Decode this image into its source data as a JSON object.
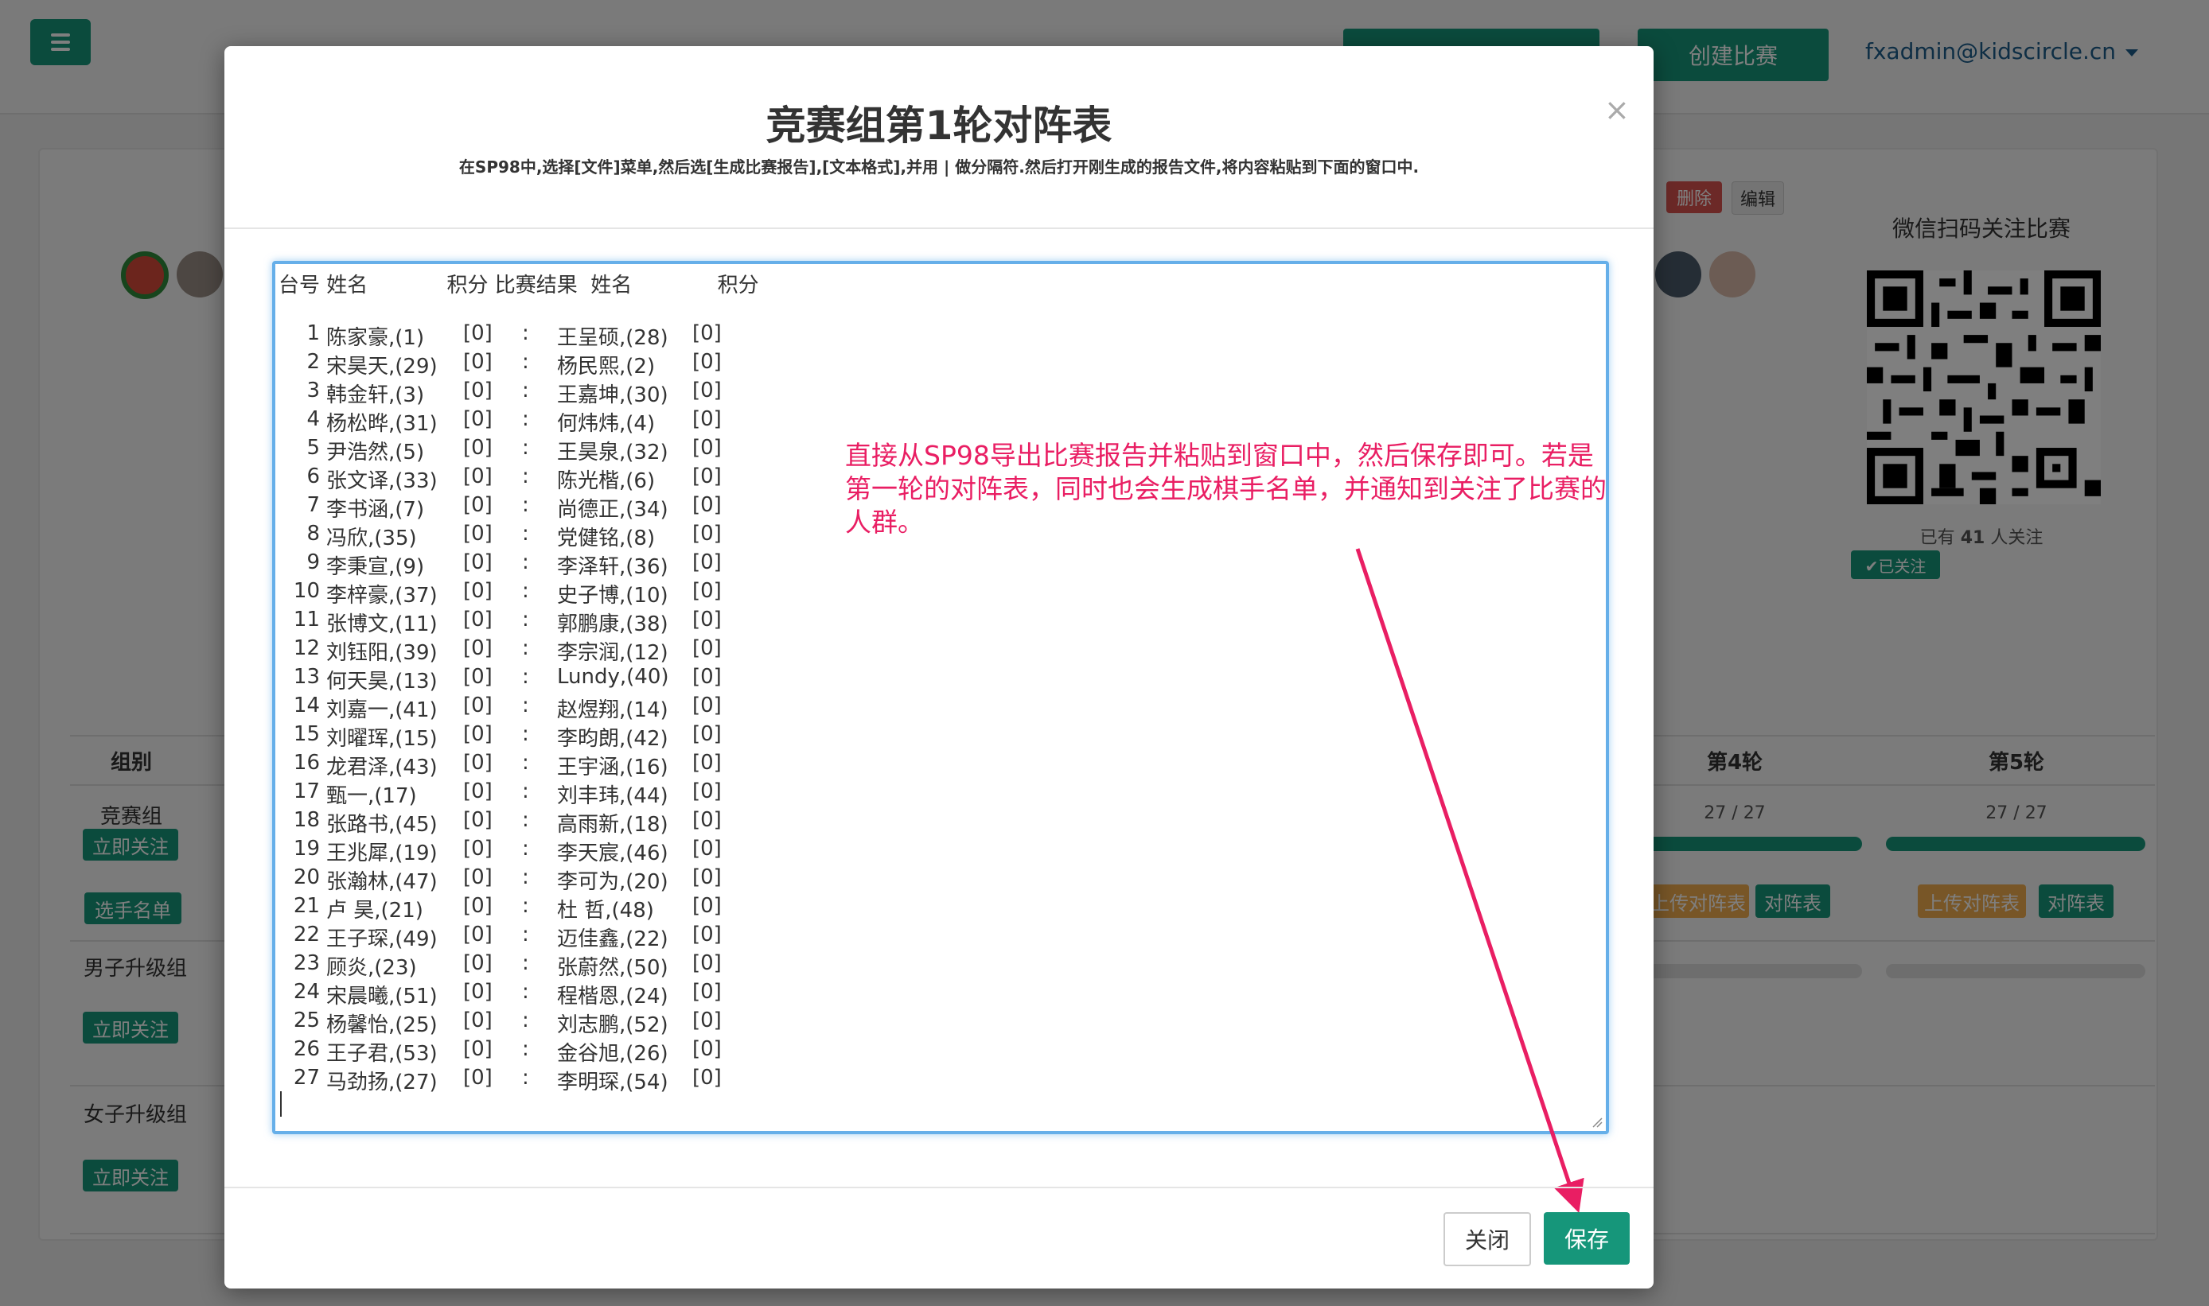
{
  "background": {
    "create_button": "创建比赛",
    "user_email": "fxadmin@kidscircle.cn",
    "delete_badge": "删除",
    "edit_badge": "编辑",
    "qr_title": "微信扫码关注比赛",
    "follow_count_prefix": "已有",
    "follow_count_value": "41",
    "follow_count_suffix": "人关注",
    "followed_badge": "✔已关注",
    "table": {
      "group_header": "组别",
      "round4_header": "第4轮",
      "round5_header": "第5轮",
      "groups": [
        {
          "name": "竞赛组",
          "follow_btn": "立即关注",
          "players_btn": "选手名单"
        },
        {
          "name": "男子升级组",
          "follow_btn": "立即关注"
        },
        {
          "name": "女子升级组",
          "follow_btn": "立即关注"
        }
      ],
      "round4_ratio": "27 / 27",
      "round5_ratio": "27 / 27",
      "round4_progress": 1.0,
      "round5_progress": 1.0,
      "upload_btn_r4": "上传对阵表",
      "pairing_btn_r4": "对阵表",
      "upload_btn_r5": "上传对阵表",
      "pairing_btn_r5": "对阵表"
    }
  },
  "modal": {
    "title": "竞赛组第1轮对阵表",
    "subtitle": "在SP98中,选择[文件]菜单,然后选[生成比赛报告],[文本格式],并用 | 做分隔符.然后打开刚生成的报告文件,将内容粘贴到下面的窗口中.",
    "close_symbol": "×",
    "textarea_header": "台号 姓名            积分 比赛结果  姓名             积分",
    "pairings": [
      {
        "no": "1",
        "p1": "陈家豪,(1)",
        "s1": "[0]",
        "sep": ":",
        "p2": "王呈硕,(28)",
        "s2": "[0]"
      },
      {
        "no": "2",
        "p1": "宋昊天,(29)",
        "s1": "[0]",
        "sep": ":",
        "p2": "杨民熙,(2)",
        "s2": "[0]"
      },
      {
        "no": "3",
        "p1": "韩金轩,(3)",
        "s1": "[0]",
        "sep": ":",
        "p2": "王嘉坤,(30)",
        "s2": "[0]"
      },
      {
        "no": "4",
        "p1": "杨松晔,(31)",
        "s1": "[0]",
        "sep": ":",
        "p2": "何炜炜,(4)",
        "s2": "[0]"
      },
      {
        "no": "5",
        "p1": "尹浩然,(5)",
        "s1": "[0]",
        "sep": ":",
        "p2": "王昊泉,(32)",
        "s2": "[0]"
      },
      {
        "no": "6",
        "p1": "张文译,(33)",
        "s1": "[0]",
        "sep": ":",
        "p2": "陈光楷,(6)",
        "s2": "[0]"
      },
      {
        "no": "7",
        "p1": "李书涵,(7)",
        "s1": "[0]",
        "sep": ":",
        "p2": "尚德正,(34)",
        "s2": "[0]"
      },
      {
        "no": "8",
        "p1": "冯欣,(35)",
        "s1": "[0]",
        "sep": ":",
        "p2": "党健铭,(8)",
        "s2": "[0]"
      },
      {
        "no": "9",
        "p1": "李秉宣,(9)",
        "s1": "[0]",
        "sep": ":",
        "p2": "李泽轩,(36)",
        "s2": "[0]"
      },
      {
        "no": "10",
        "p1": "李梓豪,(37)",
        "s1": "[0]",
        "sep": ":",
        "p2": "史子博,(10)",
        "s2": "[0]"
      },
      {
        "no": "11",
        "p1": "张博文,(11)",
        "s1": "[0]",
        "sep": ":",
        "p2": "郭鹏康,(38)",
        "s2": "[0]"
      },
      {
        "no": "12",
        "p1": "刘钰阳,(39)",
        "s1": "[0]",
        "sep": ":",
        "p2": "李宗润,(12)",
        "s2": "[0]"
      },
      {
        "no": "13",
        "p1": "何天昊,(13)",
        "s1": "[0]",
        "sep": ":",
        "p2": "Lundy,(40)",
        "s2": "[0]"
      },
      {
        "no": "14",
        "p1": "刘嘉一,(41)",
        "s1": "[0]",
        "sep": ":",
        "p2": "赵煜翔,(14)",
        "s2": "[0]"
      },
      {
        "no": "15",
        "p1": "刘曜珲,(15)",
        "s1": "[0]",
        "sep": ":",
        "p2": "李昀朗,(42)",
        "s2": "[0]"
      },
      {
        "no": "16",
        "p1": "龙君泽,(43)",
        "s1": "[0]",
        "sep": ":",
        "p2": "王宇涵,(16)",
        "s2": "[0]"
      },
      {
        "no": "17",
        "p1": "甄一,(17)",
        "s1": "[0]",
        "sep": ":",
        "p2": "刘丰玮,(44)",
        "s2": "[0]"
      },
      {
        "no": "18",
        "p1": "张路书,(45)",
        "s1": "[0]",
        "sep": ":",
        "p2": "高雨新,(18)",
        "s2": "[0]"
      },
      {
        "no": "19",
        "p1": "王兆犀,(19)",
        "s1": "[0]",
        "sep": ":",
        "p2": "李天宸,(46)",
        "s2": "[0]"
      },
      {
        "no": "20",
        "p1": "张瀚林,(47)",
        "s1": "[0]",
        "sep": ":",
        "p2": "李可为,(20)",
        "s2": "[0]"
      },
      {
        "no": "21",
        "p1": "卢 昊,(21)",
        "s1": "[0]",
        "sep": ":",
        "p2": "杜 哲,(48)",
        "s2": "[0]"
      },
      {
        "no": "22",
        "p1": "王子琛,(49)",
        "s1": "[0]",
        "sep": ":",
        "p2": "迈佳鑫,(22)",
        "s2": "[0]"
      },
      {
        "no": "23",
        "p1": "顾炎,(23)",
        "s1": "[0]",
        "sep": ":",
        "p2": "张蔚然,(50)",
        "s2": "[0]"
      },
      {
        "no": "24",
        "p1": "宋晨曦,(51)",
        "s1": "[0]",
        "sep": ":",
        "p2": "程楷恩,(24)",
        "s2": "[0]"
      },
      {
        "no": "25",
        "p1": "杨馨怡,(25)",
        "s1": "[0]",
        "sep": ":",
        "p2": "刘志鹏,(52)",
        "s2": "[0]"
      },
      {
        "no": "26",
        "p1": "王子君,(53)",
        "s1": "[0]",
        "sep": ":",
        "p2": "金谷旭,(26)",
        "s2": "[0]"
      },
      {
        "no": "27",
        "p1": "马劲扬,(27)",
        "s1": "[0]",
        "sep": ":",
        "p2": "李明琛,(54)",
        "s2": "[0]"
      }
    ],
    "annotation": "直接从SP98导出比赛报告并粘贴到窗口中，然后保存即可。若是第一轮的对阵表，同时也会生成棋手名单，并通知到关注了比赛的人群。",
    "close_button": "关闭",
    "save_button": "保存"
  },
  "colors": {
    "primary": "#16967a",
    "danger": "#d9534f",
    "warning": "#f0ad4e",
    "annotation": "#e91e63",
    "focus_border": "#66afe9"
  }
}
